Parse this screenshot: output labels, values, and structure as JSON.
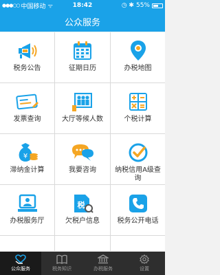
{
  "status": {
    "signal": "●●●○○",
    "carrier": "中国移动",
    "wifi": "ᯤ",
    "time": "18:42",
    "icons": "◷ ✱",
    "battery_text": "55%",
    "battery_level": 0.55
  },
  "navbar": {
    "title": "公众服务"
  },
  "grid": {
    "items": [
      {
        "label": "税务公告",
        "icon": "megaphone-icon"
      },
      {
        "label": "征期日历",
        "icon": "calendar-icon"
      },
      {
        "label": "办税地图",
        "icon": "map-pin-icon"
      },
      {
        "label": "发票查询",
        "icon": "invoice-icon"
      },
      {
        "label": "大厅等候人数",
        "icon": "queue-icon"
      },
      {
        "label": "个税计算",
        "icon": "calculator-icon"
      },
      {
        "label": "滞纳金计算",
        "icon": "money-bag-icon"
      },
      {
        "label": "我要咨询",
        "icon": "chat-icon"
      },
      {
        "label": "纳税信用A级查询",
        "icon": "check-badge-icon"
      },
      {
        "label": "办税服务厅",
        "icon": "service-hall-icon"
      },
      {
        "label": "欠税户信息",
        "icon": "tax-arrears-icon"
      },
      {
        "label": "税务公开电话",
        "icon": "phone-icon"
      }
    ]
  },
  "tabbar": {
    "tabs": [
      {
        "label": "公众服务",
        "icon": "heart-hands-icon",
        "active": true
      },
      {
        "label": "税务知识",
        "icon": "book-icon",
        "active": false
      },
      {
        "label": "办税服务",
        "icon": "building-icon",
        "active": false
      },
      {
        "label": "设置",
        "icon": "gear-icon",
        "active": false
      }
    ]
  }
}
